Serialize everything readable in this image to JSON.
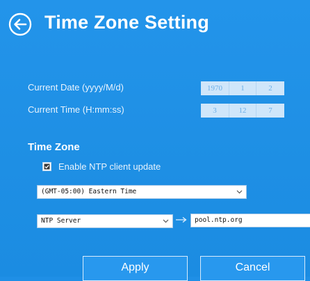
{
  "header": {
    "title": "Time Zone Setting",
    "back_icon": "back-arrow-circle-icon"
  },
  "date": {
    "label": "Current Date (yyyy/M/d)",
    "year": "1970",
    "month": "1",
    "day": "2"
  },
  "time": {
    "label": "Current Time (H:mm:ss)",
    "hour": "3",
    "minute": "12",
    "second": "7"
  },
  "timezone": {
    "section_title": "Time Zone",
    "ntp_checkbox_label": "Enable NTP client update",
    "ntp_enabled": true,
    "zone_selected": "(GMT-05:00) Eastern Time",
    "server_type_selected": "NTP Server",
    "server_address": "pool.ntp.org"
  },
  "actions": {
    "apply_label": "Apply",
    "cancel_label": "Cancel"
  },
  "colors": {
    "background": "#1f8fe6",
    "text": "#ffffff",
    "field_bg": "#cfe6fa",
    "field_text": "#6aaee8"
  }
}
